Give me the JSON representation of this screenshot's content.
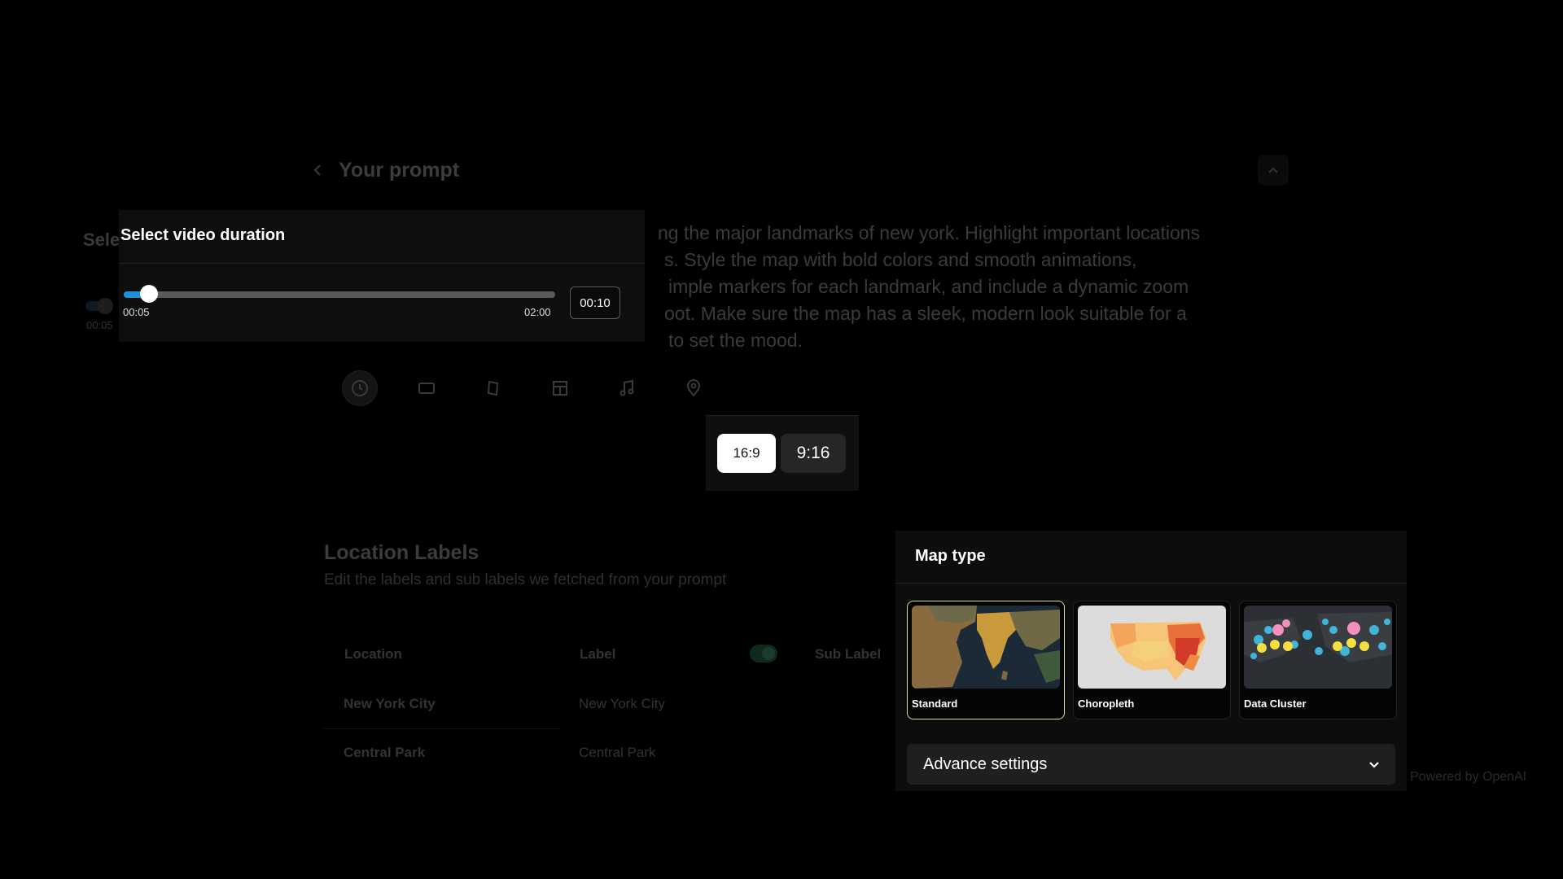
{
  "prompt": {
    "title": "Your prompt",
    "lines": [
      "ng the major landmarks of new york. Highlight important locations",
      "s. Style the map with bold colors and smooth animations,",
      "imple markers for each landmark, and include a dynamic zoom",
      "oot. Make sure the map has a sleek, modern look suitable for a",
      " to set the mood."
    ],
    "toolbar_icons": [
      "clock-icon",
      "aspect-ratio-icon",
      "map-style-icon",
      "layout-icon",
      "music-icon",
      "location-pin-icon"
    ]
  },
  "background": {
    "select_label_fragment": "Sele",
    "time_fragment": "00:05"
  },
  "duration": {
    "title": "Select video duration",
    "min_label": "00:05",
    "max_label": "02:00",
    "value": "00:10",
    "min_seconds": 5,
    "max_seconds": 120,
    "value_seconds": 10,
    "accent": "#1e90d8"
  },
  "aspect": {
    "options": [
      "16:9",
      "9:16"
    ],
    "selected": "16:9"
  },
  "location_labels": {
    "title": "Location Labels",
    "subtitle": "Edit the labels and sub labels we fetched from your prompt",
    "columns": [
      "Location",
      "Label",
      "Sub Label"
    ],
    "rows": [
      {
        "location": "New York City",
        "label": "New York City"
      },
      {
        "location": "Central Park",
        "label": "Central Park"
      }
    ]
  },
  "map_type": {
    "title": "Map type",
    "options": [
      {
        "label": "Standard",
        "selected": true
      },
      {
        "label": "Choropleth",
        "selected": false
      },
      {
        "label": "Data Cluster",
        "selected": false
      }
    ],
    "advance_label": "Advance settings"
  },
  "footer": {
    "powered": "Powered by OpenAI"
  }
}
